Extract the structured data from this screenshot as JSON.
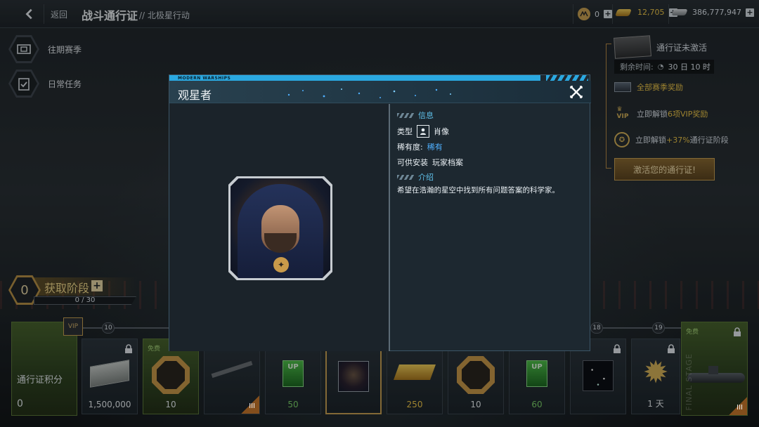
{
  "topbar": {
    "back_label": "返回",
    "title": "战斗通行证",
    "subtitle": "// 北极星行动",
    "currencies": [
      {
        "icon": "coin-icon",
        "value": "0"
      },
      {
        "icon": "gold-bar-icon",
        "value": "12,705"
      },
      {
        "icon": "dollar-stack-icon",
        "value": "386,777,947"
      }
    ],
    "colors": {
      "gold_value": "#f1c94a"
    }
  },
  "sidebar": {
    "items": [
      {
        "label": "往期赛季",
        "icon": "ticket-icon"
      },
      {
        "label": "日常任务",
        "icon": "clipboard-check-icon"
      }
    ]
  },
  "right_panel": {
    "pass_status": "通行证未激活",
    "remaining_label": "剩余时间:",
    "remaining_value": "30 日 10 时",
    "season_rewards_prefix": "全部",
    "season_rewards_suffix": "赛季奖励",
    "vip_prefix": "立即解锁",
    "vip_highlight": "6项VIP奖励",
    "boost_prefix": "立即解锁",
    "boost_highlight": "+37%",
    "boost_suffix": "通行证阶段",
    "activate_button": "激活您的通行证!"
  },
  "stage": {
    "level": "0",
    "label": "获取阶段",
    "progress": "0 / 30"
  },
  "track": {
    "points_label": "通行证积分",
    "points_value": "0",
    "vip_tag": "VIP",
    "milestones": [
      "10",
      "18",
      "19"
    ],
    "free_label": "免费",
    "cards": [
      {
        "icon": "cash-stack-icon",
        "value": "1,500,000",
        "locked": true,
        "color": "white"
      },
      {
        "icon": "emblem-icon",
        "value": "10",
        "free": true,
        "color": "white"
      },
      {
        "icon": "rifle-icon",
        "value": "",
        "tier": "III",
        "color": "white"
      },
      {
        "icon": "xp-boost-icon",
        "value": "50",
        "color": "green"
      },
      {
        "icon": "portrait-icon",
        "value": "",
        "selected": true,
        "color": "white"
      },
      {
        "icon": "gold-bars-icon",
        "value": "250",
        "color": "yellow"
      },
      {
        "icon": "emblem-icon",
        "value": "10",
        "color": "white"
      },
      {
        "icon": "xp-boost-icon",
        "value": "60",
        "color": "green"
      },
      {
        "icon": "starfield-icon",
        "value": "",
        "locked": true,
        "color": "white"
      },
      {
        "icon": "medal-star-icon",
        "value": "1 天",
        "locked": true,
        "color": "white"
      }
    ],
    "final_card": {
      "icon": "submarine-icon",
      "label": "免费",
      "tier": "III",
      "vertical_text": "FINAL STAGE"
    }
  },
  "modal": {
    "brand": "MODERN WARSHIPS",
    "title": "观星者",
    "info_header": "信息",
    "type_label": "类型",
    "type_value": "肖像",
    "rarity_label": "稀有度:",
    "rarity_value": "稀有",
    "install_label": "可供安装",
    "install_value": "玩家档案",
    "intro_header": "介绍",
    "description": "希望在浩瀚的星空中找到所有问题答案的科学家。",
    "colors": {
      "accent": "#2aa8e0",
      "rarity": "#4fb0ff"
    }
  }
}
